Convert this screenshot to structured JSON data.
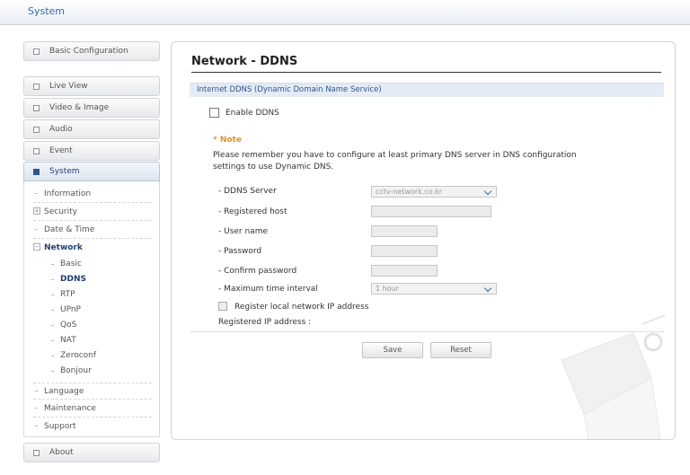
{
  "header": {
    "title": "System"
  },
  "sidebar": {
    "groups": [
      {
        "label": "Basic Configuration"
      },
      {
        "label": "Live View"
      },
      {
        "label": "Video & Image"
      },
      {
        "label": "Audio"
      },
      {
        "label": "Event"
      },
      {
        "label": "System"
      },
      {
        "label": "About"
      }
    ],
    "system_items": [
      {
        "label": "Information"
      },
      {
        "label": "Security"
      },
      {
        "label": "Date & Time"
      },
      {
        "label": "Network"
      },
      {
        "label": "Language"
      },
      {
        "label": "Maintenance"
      },
      {
        "label": "Support"
      }
    ],
    "network_items": [
      {
        "label": "Basic"
      },
      {
        "label": "DDNS"
      },
      {
        "label": "RTP"
      },
      {
        "label": "UPnP"
      },
      {
        "label": "QoS"
      },
      {
        "label": "NAT"
      },
      {
        "label": "Zeroconf"
      },
      {
        "label": "Bonjour"
      }
    ]
  },
  "main": {
    "title": "Network - DDNS",
    "section_title": "Internet DDNS (Dynamic Domain Name Service)",
    "enable_label": "Enable DDNS",
    "enable_checked": false,
    "note_label": "* Note",
    "note_text_1": "Please remember you have to configure at least primary DNS server in DNS configuration",
    "note_text_2": "settings to use Dynamic DNS.",
    "fields": {
      "ddns_server": {
        "label": "- DDNS Server",
        "value": "cctv-network.co.kr"
      },
      "registered_host": {
        "label": "- Registered host",
        "value": ""
      },
      "user_name": {
        "label": "- User name",
        "value": ""
      },
      "password": {
        "label": "- Password",
        "value": ""
      },
      "confirm_password": {
        "label": "- Confirm password",
        "value": ""
      },
      "max_interval": {
        "label": "- Maximum time interval",
        "value": "1 hour"
      }
    },
    "register_local_label": "Register local network IP address",
    "register_local_checked": false,
    "registered_ip_label": "Registered IP address :",
    "save_label": "Save",
    "reset_label": "Reset"
  }
}
